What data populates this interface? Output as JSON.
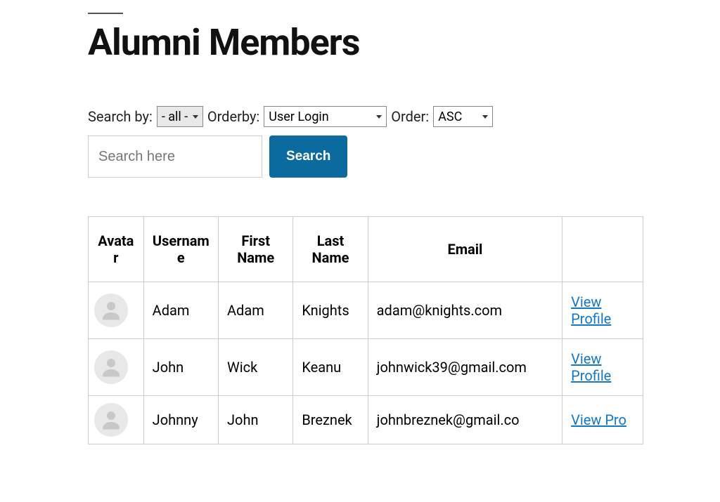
{
  "page": {
    "title": "Alumni Members"
  },
  "filters": {
    "search_by_label": "Search by:",
    "search_by_value": "- all -",
    "orderby_label": "Orderby:",
    "orderby_value": "User Login",
    "order_label": "Order:",
    "order_value": "ASC",
    "search_placeholder": "Search here",
    "search_button": "Search"
  },
  "table": {
    "headers": {
      "avatar": "Avatar",
      "username": "Username",
      "firstname": "First Name",
      "lastname": "Last Name",
      "email": "Email",
      "action": ""
    },
    "rows": [
      {
        "username": "Adam",
        "firstname": "Adam",
        "lastname": "Knights",
        "email": "adam@knights.com",
        "action": "View Profile"
      },
      {
        "username": "John",
        "firstname": "Wick",
        "lastname": "Keanu",
        "email": "johnwick39@gmail.com",
        "action": "View Profile"
      },
      {
        "username": "Johnny",
        "firstname": "John",
        "lastname": "Breznek",
        "email": "johnbreznek@gmail.co",
        "action": "View Pro"
      }
    ]
  }
}
